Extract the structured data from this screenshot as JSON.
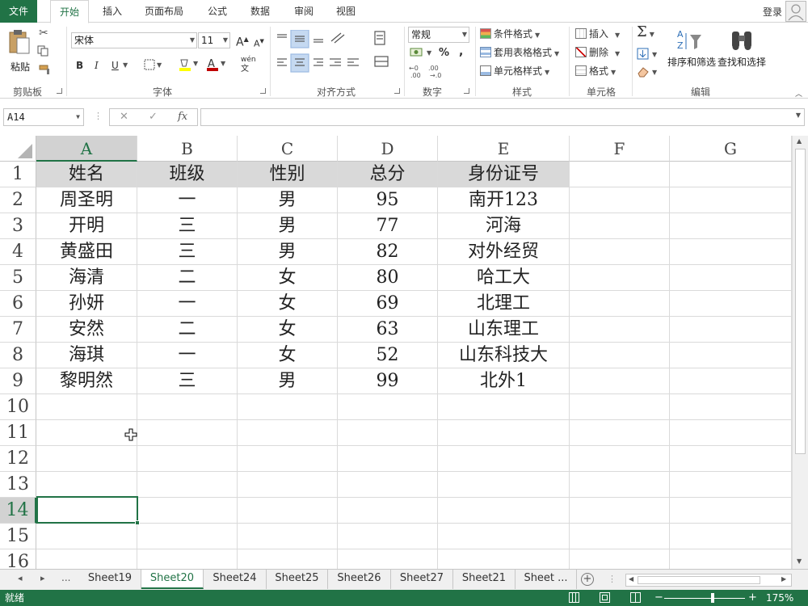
{
  "ribbon_tabs": [
    "文件",
    "开始",
    "插入",
    "页面布局",
    "公式",
    "数据",
    "审阅",
    "视图"
  ],
  "login_label": "登录",
  "clipboard": {
    "paste": "粘贴",
    "group": "剪贴板"
  },
  "font": {
    "name": "宋体",
    "size": "11",
    "group": "字体",
    "grow": "A",
    "shrink": "A",
    "bold": "B",
    "italic": "I",
    "underline": "U",
    "phonetic": "wén"
  },
  "alignment": {
    "group": "对齐方式"
  },
  "number": {
    "format": "常规",
    "percent": "%",
    "comma": ",",
    "group": "数字"
  },
  "styles": {
    "conditional": "条件格式",
    "table": "套用表格格式",
    "cell": "单元格样式",
    "group": "样式"
  },
  "cells": {
    "insert": "插入",
    "delete": "删除",
    "format": "格式",
    "group": "单元格"
  },
  "editing": {
    "sum": "Σ",
    "sort": "排序和筛选",
    "find": "查找和选择",
    "group": "编辑"
  },
  "formula_bar": {
    "name_box": "A14",
    "fx": "fx",
    "cancel": "✕",
    "enter": "✓",
    "value": ""
  },
  "columns": [
    "A",
    "B",
    "C",
    "D",
    "E",
    "F",
    "G"
  ],
  "rows": [
    "1",
    "2",
    "3",
    "4",
    "5",
    "6",
    "7",
    "8",
    "9",
    "10",
    "11",
    "12",
    "13",
    "14",
    "15",
    "16"
  ],
  "table": {
    "headers": [
      "姓名",
      "班级",
      "性别",
      "总分",
      "身份证号"
    ],
    "data": [
      [
        "周圣明",
        "一",
        "男",
        "95",
        "南开123"
      ],
      [
        "开明",
        "三",
        "男",
        "77",
        "河海"
      ],
      [
        "黄盛田",
        "三",
        "男",
        "82",
        "对外经贸"
      ],
      [
        "海清",
        "二",
        "女",
        "80",
        "哈工大"
      ],
      [
        "孙妍",
        "一",
        "女",
        "69",
        "北理工"
      ],
      [
        "安然",
        "二",
        "女",
        "63",
        "山东理工"
      ],
      [
        "海琪",
        "一",
        "女",
        "52",
        "山东科技大"
      ],
      [
        "黎明然",
        "三",
        "男",
        "99",
        "北外1"
      ]
    ]
  },
  "sheet_nav": {
    "prev": "◂",
    "next": "▸",
    "more": "...",
    "add": "+"
  },
  "sheets": [
    "Sheet19",
    "Sheet20",
    "Sheet24",
    "Sheet25",
    "Sheet26",
    "Sheet27",
    "Sheet21",
    "Sheet ..."
  ],
  "active_sheet": "Sheet20",
  "status": {
    "ready": "就绪",
    "zoom": "175%",
    "zoom_minus": "−",
    "zoom_plus": "+"
  },
  "colors": {
    "accent": "#217346",
    "header_fill": "#d9d9d9"
  }
}
